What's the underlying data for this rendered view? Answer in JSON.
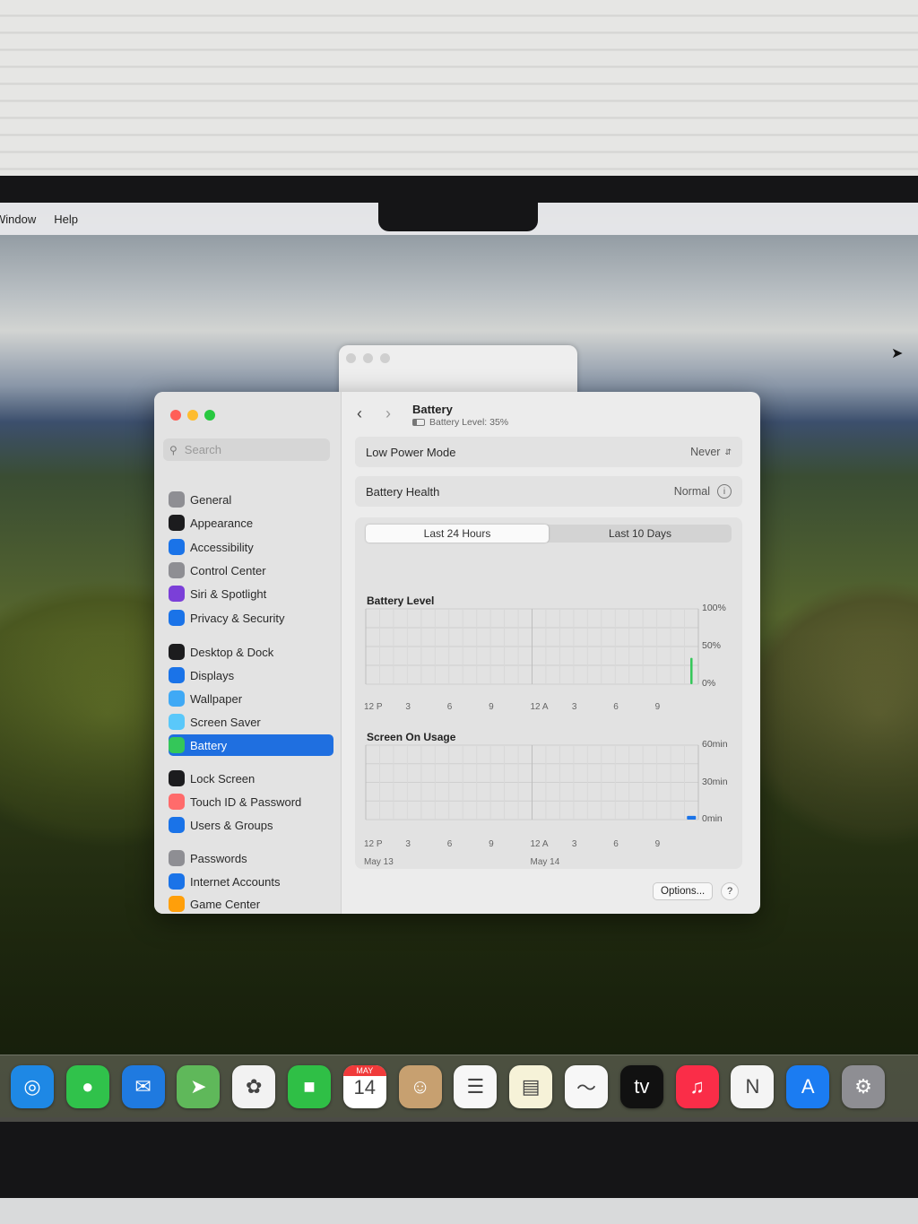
{
  "menubar": {
    "items": [
      "Window",
      "Help"
    ]
  },
  "sidebar": {
    "search_placeholder": "Search",
    "items": [
      {
        "label": "General",
        "icon": "gear-icon",
        "color": "#8e8e93"
      },
      {
        "label": "Appearance",
        "icon": "appearance-icon",
        "color": "#1c1c1e"
      },
      {
        "label": "Accessibility",
        "icon": "accessibility-icon",
        "color": "#1a73e8"
      },
      {
        "label": "Control Center",
        "icon": "control-center-icon",
        "color": "#8e8e93"
      },
      {
        "label": "Siri & Spotlight",
        "icon": "siri-icon",
        "color": "#7b3fd8"
      },
      {
        "label": "Privacy & Security",
        "icon": "hand-icon",
        "color": "#1a73e8"
      },
      {
        "label": "Desktop & Dock",
        "icon": "desktop-icon",
        "color": "#1c1c1e"
      },
      {
        "label": "Displays",
        "icon": "displays-icon",
        "color": "#1a73e8"
      },
      {
        "label": "Wallpaper",
        "icon": "wallpaper-icon",
        "color": "#3fa9f5"
      },
      {
        "label": "Screen Saver",
        "icon": "screen-saver-icon",
        "color": "#5ac8fa"
      },
      {
        "label": "Battery",
        "icon": "battery-icon",
        "color": "#34c759"
      },
      {
        "label": "Lock Screen",
        "icon": "lock-icon",
        "color": "#1c1c1e"
      },
      {
        "label": "Touch ID & Password",
        "icon": "fingerprint-icon",
        "color": "#ff6b6b"
      },
      {
        "label": "Users & Groups",
        "icon": "users-icon",
        "color": "#1a73e8"
      },
      {
        "label": "Passwords",
        "icon": "key-icon",
        "color": "#8e8e93"
      },
      {
        "label": "Internet Accounts",
        "icon": "at-icon",
        "color": "#1a73e8"
      },
      {
        "label": "Game Center",
        "icon": "game-center-icon",
        "color": "#ff9f0a"
      }
    ],
    "selected": "Battery"
  },
  "header": {
    "title": "Battery",
    "subtitle": "Battery Level: 35%"
  },
  "low_power": {
    "label": "Low Power Mode",
    "value": "Never"
  },
  "health": {
    "label": "Battery Health",
    "value": "Normal"
  },
  "tabs": [
    "Last 24 Hours",
    "Last 10 Days"
  ],
  "active_tab": "Last 24 Hours",
  "chart_data": [
    {
      "type": "bar",
      "title": "Battery Level",
      "categories": [
        "12 P",
        "3",
        "6",
        "9",
        "12 A",
        "3",
        "6",
        "9"
      ],
      "yticks": [
        "100%",
        "50%",
        "0%"
      ],
      "ylim": [
        0,
        100
      ],
      "values": [
        {
          "x": 23.5,
          "y": 35,
          "color": "#34c759"
        }
      ]
    },
    {
      "type": "bar",
      "title": "Screen On Usage",
      "categories": [
        "12 P",
        "3",
        "6",
        "9",
        "12 A",
        "3",
        "6",
        "9"
      ],
      "dates": [
        "May 13",
        "May 14"
      ],
      "yticks": [
        "60min",
        "30min",
        "0min"
      ],
      "ylim": [
        0,
        60
      ],
      "values": [
        {
          "x": 23.5,
          "y": 3,
          "color": "#1a73e8"
        }
      ]
    }
  ],
  "buttons": {
    "options": "Options...",
    "help": "?"
  },
  "dock": {
    "apps": [
      {
        "name": "safari-icon",
        "color": "#1e88e5",
        "glyph": "◎"
      },
      {
        "name": "messages-icon",
        "color": "#30c24b",
        "glyph": "●"
      },
      {
        "name": "mail-icon",
        "color": "#1f7ae0",
        "glyph": "✉"
      },
      {
        "name": "maps-icon",
        "color": "#5fb85a",
        "glyph": "➤"
      },
      {
        "name": "photos-icon",
        "color": "#f2f2f2",
        "glyph": "✿"
      },
      {
        "name": "facetime-icon",
        "color": "#2fbf46",
        "glyph": "■"
      },
      {
        "name": "calendar-icon",
        "color": "#ffffff",
        "glyph": "14",
        "month": "MAY"
      },
      {
        "name": "contacts-icon",
        "color": "#c7a070",
        "glyph": "☺"
      },
      {
        "name": "reminders-icon",
        "color": "#f7f7f7",
        "glyph": "☰"
      },
      {
        "name": "notes-icon",
        "color": "#f6f2d8",
        "glyph": "▤"
      },
      {
        "name": "freeform-icon",
        "color": "#f7f7f7",
        "glyph": "〜"
      },
      {
        "name": "apple-tv-icon",
        "color": "#111111",
        "glyph": "tv"
      },
      {
        "name": "music-icon",
        "color": "#fa2d48",
        "glyph": "♫"
      },
      {
        "name": "news-icon",
        "color": "#f4f4f4",
        "glyph": "N"
      },
      {
        "name": "app-store-icon",
        "color": "#1b7cf2",
        "glyph": "A"
      },
      {
        "name": "system-settings-icon",
        "color": "#8e8e93",
        "glyph": "⚙"
      }
    ]
  }
}
